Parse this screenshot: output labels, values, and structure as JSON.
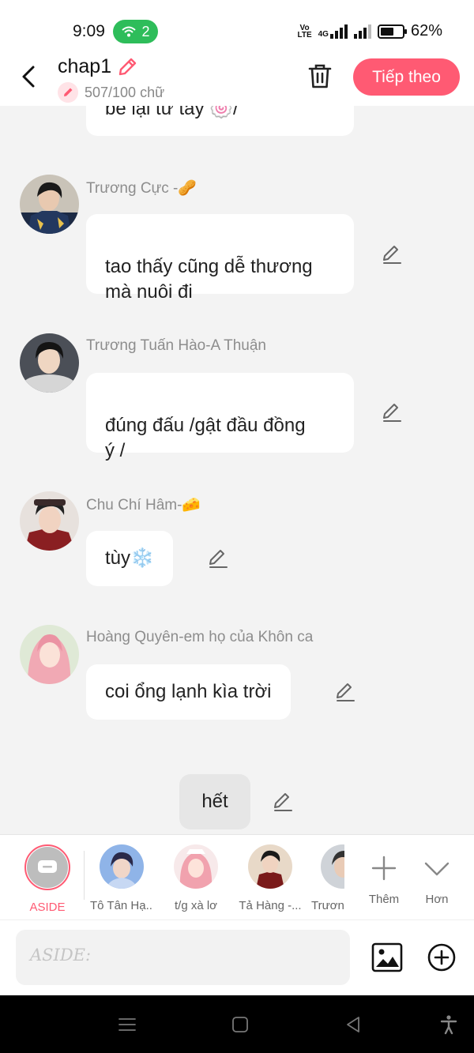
{
  "status_bar": {
    "time": "9:09",
    "hotspot_count": "2",
    "network": "4G",
    "battery_percent": "62%",
    "battery_level": 0.62
  },
  "header": {
    "title": "chap1",
    "word_count": "507/100 chữ",
    "next_button": "Tiếp theo"
  },
  "messages": [
    {
      "sender": "",
      "text": "bé lại từ tay 🍥/"
    },
    {
      "sender": "Trương Cực -🥜",
      "text": "tao thấy cũng dễ thương\nmà nuôi đi"
    },
    {
      "sender": "Trương Tuấn Hào-A Thuận",
      "text": "đúng đấu /gật đầu đồng\ný /"
    },
    {
      "sender": "Chu Chí Hâm-🧀",
      "text": "tùy❄️"
    },
    {
      "sender": "Hoàng Quyên-em họ của Khôn ca",
      "text": "coi ổng lạnh kìa trời"
    },
    {
      "sender": "",
      "text": "hết"
    }
  ],
  "characters": [
    {
      "label": "ASIDE"
    },
    {
      "label": "Tô Tân Hạ..."
    },
    {
      "label": "t/g xà lơ"
    },
    {
      "label": "Tả Hàng -..."
    },
    {
      "label": "Trươn"
    },
    {
      "label": "Thêm"
    },
    {
      "label": "Hơn"
    }
  ],
  "input": {
    "placeholder": "ASIDE:"
  },
  "colors": {
    "accent": "#ff5a73",
    "hotspot": "#2ebd5a",
    "background": "#f3f3f3"
  },
  "icons": [
    "back-icon",
    "pencil-icon",
    "trash-icon",
    "edit-icon",
    "image-icon",
    "add-circle-icon",
    "plus-icon",
    "chevron-down-icon",
    "menu-icon",
    "home-icon",
    "back-triangle-icon",
    "accessibility-icon"
  ]
}
